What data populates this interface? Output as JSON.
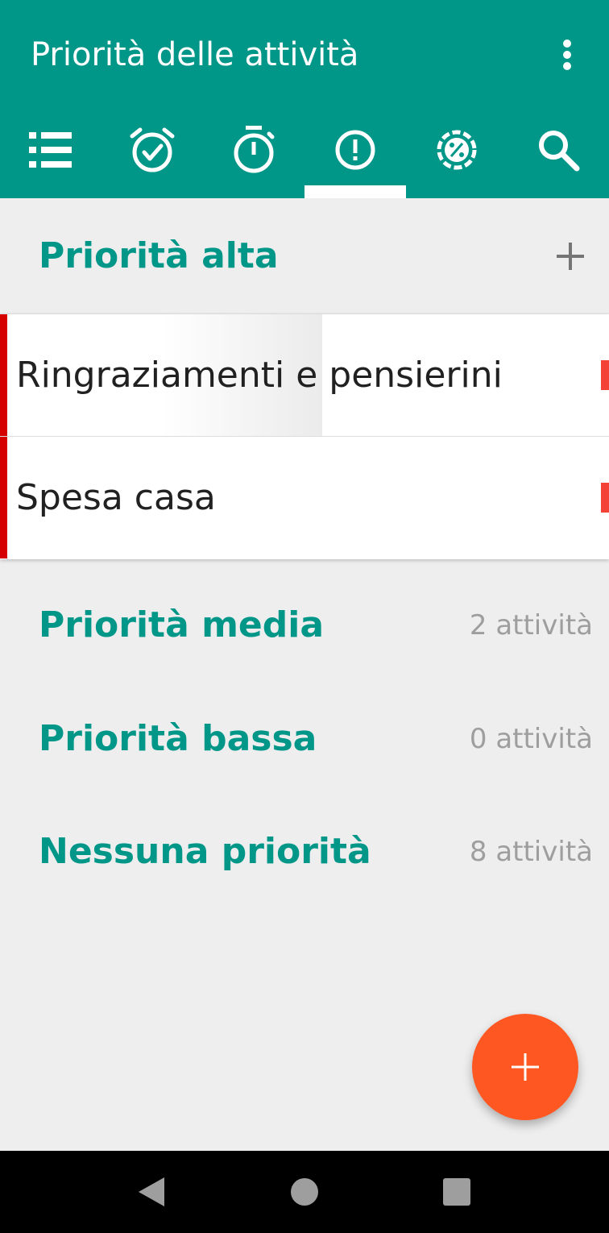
{
  "app": {
    "title": "Priorità delle attività"
  },
  "tabs": [
    {
      "icon": "list-icon",
      "selected": false
    },
    {
      "icon": "alarm-check-icon",
      "selected": false
    },
    {
      "icon": "stopwatch-icon",
      "selected": false
    },
    {
      "icon": "priority-alert-icon",
      "selected": true
    },
    {
      "icon": "progress-percent-icon",
      "selected": false
    },
    {
      "icon": "search-icon",
      "selected": false
    }
  ],
  "sections": {
    "high": {
      "title": "Priorità alta",
      "tasks": [
        {
          "label": "Ringraziamenti e pensierini"
        },
        {
          "label": "Spesa casa"
        }
      ]
    },
    "medium": {
      "title": "Priorità media",
      "count": "2 attività"
    },
    "low": {
      "title": "Priorità bassa",
      "count": "0 attività"
    },
    "none": {
      "title": "Nessuna priorità",
      "count": "8 attività"
    }
  },
  "colors": {
    "primary": "#009688",
    "accent": "#ff5722",
    "high_priority": "#d50000"
  },
  "icons": {
    "fab": "plus-icon",
    "overflow": "more-vert-icon",
    "nav": [
      "back-icon",
      "home-icon",
      "recents-icon"
    ]
  }
}
